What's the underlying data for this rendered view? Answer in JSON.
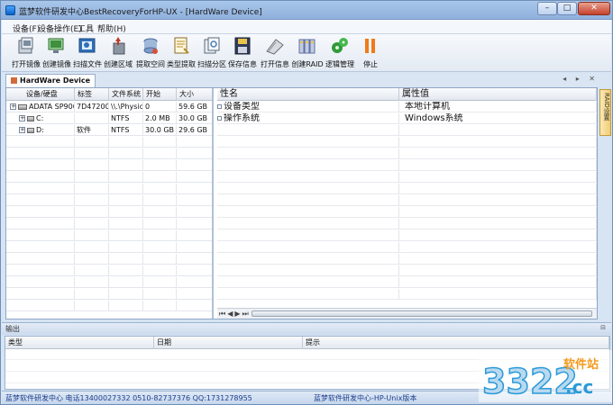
{
  "window": {
    "title": "蓝梦软件研发中心BestRecoveryForHP-UX - [HardWare Device]",
    "min_label": "–",
    "max_label": "□",
    "close_label": "✕"
  },
  "menu": [
    {
      "label": "设备(F)"
    },
    {
      "label": "设备操作(E)"
    },
    {
      "label": "工具"
    },
    {
      "label": "帮助(H)"
    }
  ],
  "toolbar": [
    {
      "label": "打开镜像",
      "icon": "open-image-icon",
      "color": "#6b7d8f"
    },
    {
      "label": "创建镜像",
      "icon": "create-image-icon",
      "color": "#3e8f3e"
    },
    {
      "label": "扫描文件",
      "icon": "scan-file-icon",
      "color": "#2f6fb8"
    },
    {
      "label": "创建区域",
      "icon": "create-region-icon",
      "color": "#c0392b"
    },
    {
      "label": "提取空间",
      "icon": "extract-space-icon",
      "color": "#4a6aa0"
    },
    {
      "label": "类型提取",
      "icon": "type-extract-icon",
      "color": "#b58a2f"
    },
    {
      "label": "扫描分区",
      "icon": "scan-partition-icon",
      "color": "#4e7fb5"
    },
    {
      "label": "保存信息",
      "icon": "save-info-icon",
      "color": "#2f3b5c"
    },
    {
      "label": "打开信息",
      "icon": "open-info-icon",
      "color": "#8a8f96"
    },
    {
      "label": "创建RAID",
      "icon": "create-raid-icon",
      "color": "#5f6fa5"
    },
    {
      "label": "逻辑管理",
      "icon": "logic-manage-icon",
      "color": "#2f9a3a"
    },
    {
      "label": "停止",
      "icon": "stop-icon",
      "color": "#f07a1a"
    }
  ],
  "doc_tab": {
    "label": "HardWare Device",
    "nav": "◂ ▸ ✕"
  },
  "device_table": {
    "columns": [
      "设备/硬盘",
      "标签",
      "文件系统",
      "开始",
      "大小"
    ],
    "rows": [
      {
        "name": "ADATA SP900...",
        "label": "7D472000...",
        "fs": "\\\\.\\Physic...",
        "start": "0",
        "size": "59.6 GB",
        "level": 0,
        "expander": "+"
      },
      {
        "name": "C:",
        "label": "",
        "fs": "NTFS",
        "start": "2.0 MB",
        "size": "30.0 GB",
        "level": 1,
        "expander": "+"
      },
      {
        "name": "D:",
        "label": "软件",
        "fs": "NTFS",
        "start": "30.0 GB",
        "size": "29.6 GB",
        "level": 1,
        "expander": "+"
      }
    ]
  },
  "properties": {
    "columns": [
      "性名",
      "属性值"
    ],
    "rows": [
      {
        "name": "设备类型",
        "value": "本地计算机"
      },
      {
        "name": "操作系统",
        "value": "Windows系统"
      }
    ]
  },
  "scroll_nav": "⏮◀▶⏭",
  "side_tab": {
    "label": "RAID设置"
  },
  "output": {
    "title": "输出",
    "pin": "⊟",
    "columns": [
      "类型",
      "日期",
      "提示"
    ]
  },
  "status": {
    "left": "蓝梦软件研发中心 电话13400027332 0510-82737376 QQ:1731278955",
    "right": "蓝梦软件研发中心-HP-Unix版本"
  },
  "watermark": {
    "number": "3322",
    "tag": "软件站",
    "domain": ".cc"
  }
}
